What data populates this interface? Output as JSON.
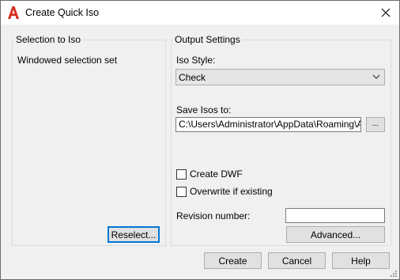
{
  "window": {
    "title": "Create Quick Iso",
    "icon": "autocad-a-icon",
    "close_icon": "close-icon"
  },
  "selection_group": {
    "label": "Selection to Iso",
    "status": "Windowed selection set",
    "reselect_button": "Reselect..."
  },
  "output_group": {
    "label": "Output Settings",
    "iso_style_label": "Iso Style:",
    "iso_style_value": "Check",
    "save_label": "Save Isos to:",
    "save_path": "C:\\Users\\Administrator\\AppData\\Roaming\\Autoc",
    "browse_button": "...",
    "create_dwf_label": "Create DWF",
    "create_dwf_checked": false,
    "overwrite_label": "Overwrite if existing",
    "overwrite_checked": false,
    "revision_label": "Revision number:",
    "revision_value": "",
    "advanced_button": "Advanced..."
  },
  "footer": {
    "create_button": "Create",
    "cancel_button": "Cancel",
    "help_button": "Help"
  }
}
